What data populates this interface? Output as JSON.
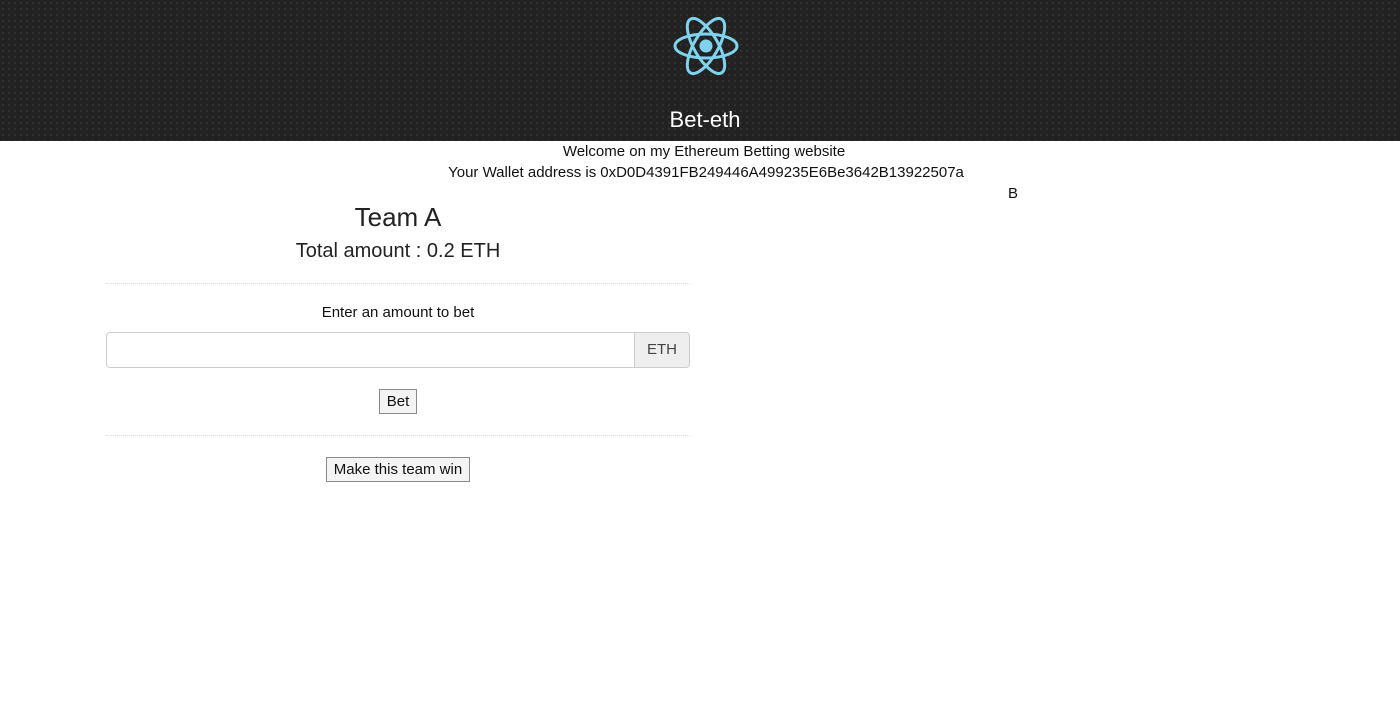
{
  "header": {
    "logo_icon": "react-atom-logo-icon",
    "accent_color": "#7fd3ee",
    "title": "Bet-eth"
  },
  "intro": {
    "welcome_text": "Welcome on my Ethereum Betting website",
    "wallet_prefix": "Your Wallet address is",
    "wallet_address": "0xD0D4391FB249446A499235E6Be3642B13922507a"
  },
  "team_b": {
    "name": "B"
  },
  "team_a": {
    "name": "Team A",
    "total_label": "Total amount : 0.2 ETH",
    "bet_prompt": "Enter an amount to bet",
    "amount_value": "",
    "amount_placeholder": "",
    "currency_addon": "ETH",
    "bet_button": "Bet",
    "win_button": "Make this team win"
  }
}
